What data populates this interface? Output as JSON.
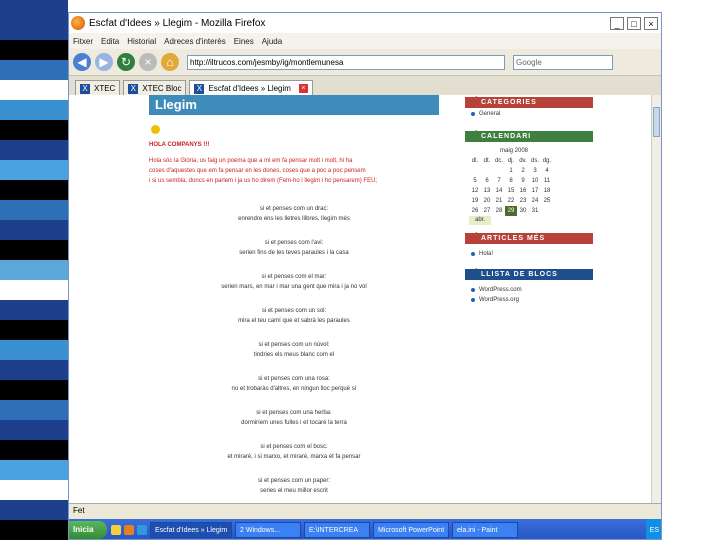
{
  "window": {
    "title": "Escfat d'Idees » Llegim - Mozilla Firefox",
    "buttons": {
      "minimize": "_",
      "maximize": "□",
      "close": "×"
    }
  },
  "menu": [
    "Fitxer",
    "Edita",
    "Historial",
    "Adreces d'interès",
    "Eines",
    "Ajuda"
  ],
  "nav": {
    "url": "http://iltrucos.com/jesmby/ig/montlemunesa",
    "search_placeholder": "Google"
  },
  "tabs": [
    {
      "label": "XTEC",
      "active": false
    },
    {
      "label": "XTEC Bloc",
      "active": false
    },
    {
      "label": "Escfat d'Idees » Llegim",
      "active": true
    }
  ],
  "page": {
    "title": "Llegim",
    "greeting": "HOLA COMPANYS !!!",
    "intro": [
      "Hola sóc la Glória, us faig un poema que a mi em fa pensar molt i molt, hi ha",
      "coses d'aquestes que em fa pensar en les dones, coses que a poc a poc pensem",
      "i si us sembla, doncs en parlem i ja us ho direm (Fem-ho i llegim i ho pensarem) FEU;"
    ],
    "stanzas": [
      [
        "si et penses com un drac:",
        "enrendre ens les lletres llibres, llegim més"
      ],
      [
        "si et penses com l'avi:",
        "serien fins de les teves paraules i la casa"
      ],
      [
        "si et penses com el mar:",
        "serien mars, en mar i mar una gent que mira i ja no vol"
      ],
      [
        "si et penses com un sol:",
        "mira el teu camí que et sabrà les paraules"
      ],
      [
        "si et penses com un núvol:",
        "tindries els meus blanc com el"
      ],
      [
        "si et penses com una rosa:",
        "no et trobaràs d'altres, en ningun lloc perquè sí"
      ],
      [
        "si et penses com una herba:",
        "dormiríem unes fulles i et tocaré la terra"
      ],
      [
        "si et penses com el bosc:",
        "et miraré, i si marxo, et miraré, marxa et fa pensar"
      ],
      [
        "si et penses com un paper:",
        "series el meu millor escrit"
      ]
    ]
  },
  "sidebar": {
    "categories_header": "CATEGORIES",
    "categories": [
      "General"
    ],
    "calendar_header": "CALENDARI",
    "calendar": {
      "month": "maig 2008",
      "days_header": [
        "dl.",
        "dt.",
        "dc.",
        "dj.",
        "dv.",
        "ds.",
        "dg."
      ],
      "weeks": [
        [
          "",
          "",
          "",
          "1",
          "2",
          "3",
          "4"
        ],
        [
          "5",
          "6",
          "7",
          "8",
          "9",
          "10",
          "11"
        ],
        [
          "12",
          "13",
          "14",
          "15",
          "16",
          "17",
          "18"
        ],
        [
          "19",
          "20",
          "21",
          "22",
          "23",
          "24",
          "25"
        ],
        [
          "26",
          "27",
          "28",
          "29",
          "30",
          "31",
          ""
        ]
      ],
      "today": "29",
      "prev_link": "abr."
    },
    "articles_header": "ARTICLES MÉS",
    "articles": [
      "Hola!"
    ],
    "blogs_header": "LLISTA DE BLOCS",
    "blogs": [
      "WordPress.com",
      "WordPress.org"
    ]
  },
  "status": {
    "text": "Fet"
  },
  "taskbar": {
    "start": "Inicia",
    "tasks": [
      {
        "label": "Escfat d'Idees » Llegim",
        "active": true
      },
      {
        "label": "2 Windows...",
        "active": false
      },
      {
        "label": "E:\\INTERCREA",
        "active": false
      },
      {
        "label": "Microsoft PowerPoint",
        "active": false
      },
      {
        "label": "ela.ini - Paint",
        "active": false
      }
    ],
    "tray": "ES"
  },
  "colors": {
    "slide_band": [
      "#1e3f8c",
      "#1e3f8c",
      "#000000",
      "#2e6fb8",
      "#ffffff",
      "#3a8fd0",
      "#000000",
      "#1e3f8c",
      "#4aa3e0",
      "#000000",
      "#2e6fb8",
      "#1e3f8c",
      "#000000",
      "#5aa8d8",
      "#ffffff",
      "#1e3f8c",
      "#000000",
      "#3a8fd0",
      "#1e3f8c",
      "#000000",
      "#2e6fb8",
      "#1e3f8c",
      "#000000",
      "#4aa3e0",
      "#ffffff",
      "#1e3f8c",
      "#000000"
    ],
    "header_red": "#b6423a",
    "header_green": "#3f7f3f",
    "header_blue": "#1e4f8c",
    "blog_title_bg": "#3f8bb9"
  }
}
